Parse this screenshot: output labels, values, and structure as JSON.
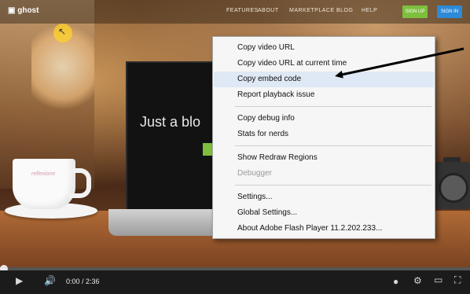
{
  "video": {
    "brand_logo": "ghost",
    "nav_links": [
      "FEATURES",
      "ABOUT",
      "MARKETPLACE",
      "BLOG",
      "HELP"
    ],
    "nav_buttons": {
      "signup": "SIGN UP",
      "signin": "SIGN IN"
    },
    "laptop_headline": "Just a blo",
    "cup_text": "reflexione"
  },
  "context_menu": {
    "items": [
      {
        "label": "Copy video URL",
        "state": "normal"
      },
      {
        "label": "Copy video URL at current time",
        "state": "normal"
      },
      {
        "label": "Copy embed code",
        "state": "highlighted"
      },
      {
        "label": "Report playback issue",
        "state": "normal"
      },
      {
        "label": "Copy debug info",
        "state": "normal"
      },
      {
        "label": "Stats for nerds",
        "state": "normal"
      },
      {
        "label": "Show Redraw Regions",
        "state": "normal"
      },
      {
        "label": "Debugger",
        "state": "disabled"
      },
      {
        "label": "Settings...",
        "state": "normal"
      },
      {
        "label": "Global Settings...",
        "state": "normal"
      },
      {
        "label": "About Adobe Flash Player 11.2.202.233...",
        "state": "normal"
      }
    ]
  },
  "player": {
    "current_time": "0:00",
    "duration": "2:36",
    "time_separator": " / ",
    "progress_fraction": 0.01,
    "icons": [
      "play-icon",
      "volume-icon",
      "annotations-icon",
      "settings-gear-icon",
      "theater-mode-icon",
      "fullscreen-icon"
    ]
  },
  "colors": {
    "signup_green": "#7ebf3e",
    "signin_blue": "#2d8ad6",
    "menu_highlight": "#dfe8f5",
    "menu_disabled_text": "#9a9a9a"
  }
}
